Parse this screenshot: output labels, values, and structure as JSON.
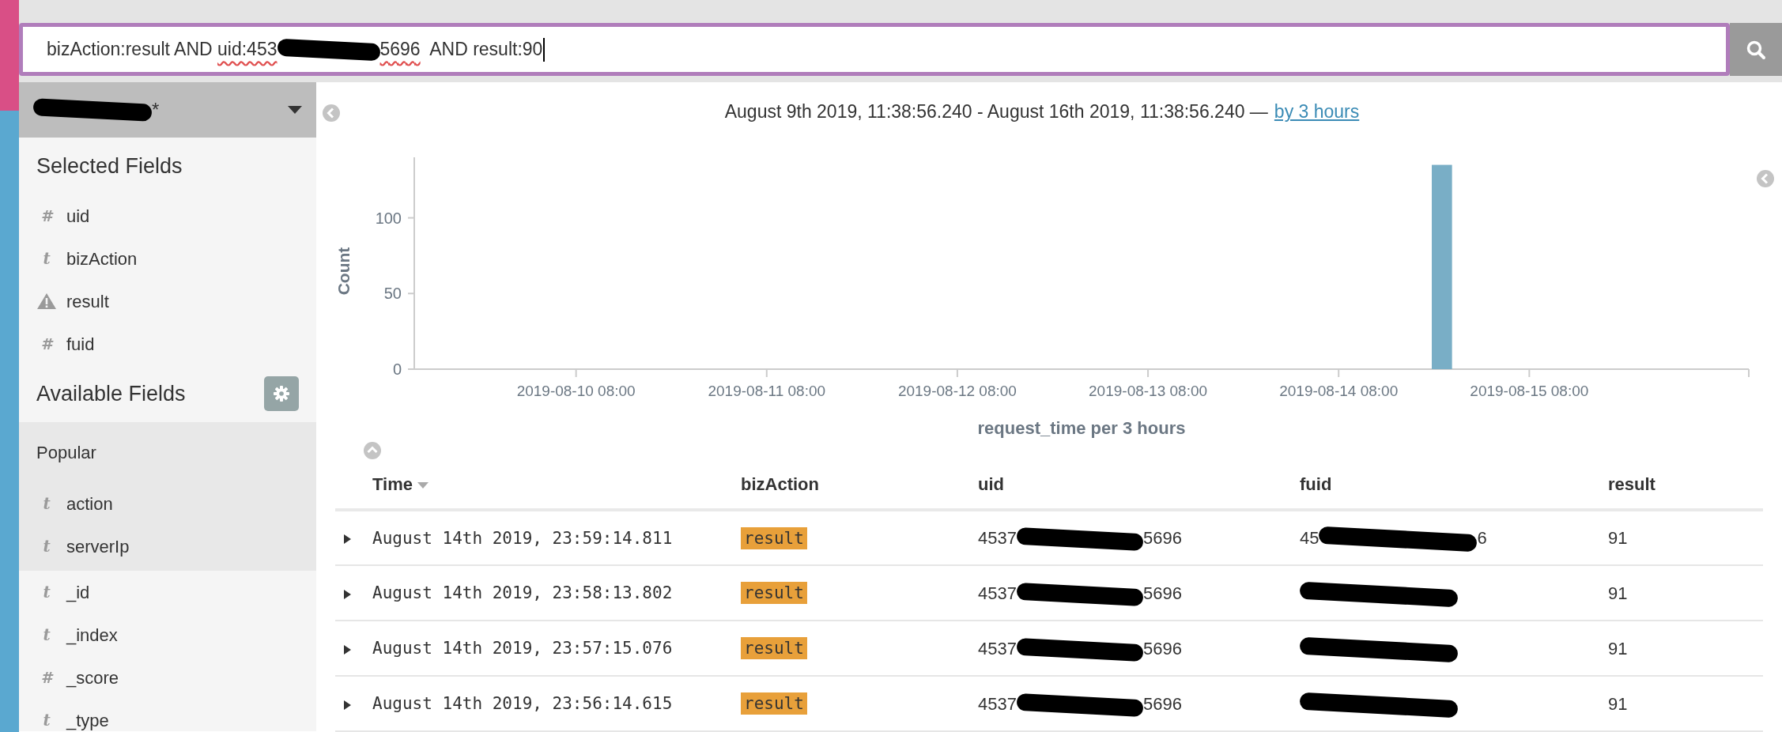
{
  "query": {
    "parts": [
      {
        "kind": "text",
        "text": "bizAction:result AND ",
        "misspelled": false
      },
      {
        "kind": "text",
        "text": "uid:453",
        "misspelled": true
      },
      {
        "kind": "redacted"
      },
      {
        "kind": "text",
        "text": "5696",
        "misspelled": true
      },
      {
        "kind": "text",
        "text": "  AND result:90",
        "misspelled": false
      }
    ]
  },
  "index_pattern": {
    "parts": [
      {
        "kind": "redacted"
      },
      {
        "kind": "text",
        "text": "*"
      }
    ]
  },
  "time_range": {
    "text": "August 9th 2019, 11:38:56.240 - August 16th 2019, 11:38:56.240 —",
    "interval_link": "by 3 hours"
  },
  "sidebar": {
    "selected_title": "Selected Fields",
    "selected_fields": [
      {
        "kind": "number",
        "icon": "#",
        "name": "uid"
      },
      {
        "kind": "string",
        "icon": "t",
        "name": "bizAction"
      },
      {
        "kind": "warning",
        "name": "result"
      },
      {
        "kind": "number",
        "icon": "#",
        "name": "fuid"
      }
    ],
    "available_title": "Available Fields",
    "popular_title": "Popular",
    "popular_fields": [
      {
        "kind": "string",
        "icon": "t",
        "name": "action"
      },
      {
        "kind": "string",
        "icon": "t",
        "name": "serverIp"
      }
    ],
    "other_fields": [
      {
        "kind": "string",
        "icon": "t",
        "name": "_id"
      },
      {
        "kind": "string",
        "icon": "t",
        "name": "_index"
      },
      {
        "kind": "number",
        "icon": "#",
        "name": "_score"
      },
      {
        "kind": "string",
        "icon": "t",
        "name": "_type"
      }
    ]
  },
  "chart_data": {
    "type": "bar",
    "xlabel": "request_time per 3 hours",
    "ylabel": "Count",
    "x": [
      "2019-08-14 21:00"
    ],
    "values": [
      135
    ],
    "xlim": [
      "2019-08-09 11:38",
      "2019-08-16 11:38"
    ],
    "ylim": [
      0,
      140
    ],
    "xticks": [
      "2019-08-10 08:00",
      "2019-08-11 08:00",
      "2019-08-12 08:00",
      "2019-08-13 08:00",
      "2019-08-14 08:00",
      "2019-08-15 08:00"
    ],
    "yticks": [
      0,
      50,
      100
    ]
  },
  "table": {
    "columns": [
      {
        "label": "Time",
        "sorted": true
      },
      {
        "label": "bizAction",
        "sorted": false
      },
      {
        "label": "uid",
        "sorted": false
      },
      {
        "label": "fuid",
        "sorted": false
      },
      {
        "label": "result",
        "sorted": false
      }
    ],
    "rows": [
      {
        "time": "August 14th 2019, 23:59:14.811",
        "bizAction": "result",
        "uid": [
          {
            "kind": "text",
            "text": "4537"
          },
          {
            "kind": "redacted"
          },
          {
            "kind": "text",
            "text": "5696"
          }
        ],
        "fuid": [
          {
            "kind": "text",
            "text": "45"
          },
          {
            "kind": "redacted"
          },
          {
            "kind": "text",
            "text": "6"
          }
        ],
        "result": "91"
      },
      {
        "time": "August 14th 2019, 23:58:13.802",
        "bizAction": "result",
        "uid": [
          {
            "kind": "text",
            "text": "4537"
          },
          {
            "kind": "redacted"
          },
          {
            "kind": "text",
            "text": "5696"
          }
        ],
        "fuid": [
          {
            "kind": "redacted"
          }
        ],
        "result": "91"
      },
      {
        "time": "August 14th 2019, 23:57:15.076",
        "bizAction": "result",
        "uid": [
          {
            "kind": "text",
            "text": "4537"
          },
          {
            "kind": "redacted"
          },
          {
            "kind": "text",
            "text": "5696"
          }
        ],
        "fuid": [
          {
            "kind": "redacted"
          }
        ],
        "result": "91"
      },
      {
        "time": "August 14th 2019, 23:56:14.615",
        "bizAction": "result",
        "uid": [
          {
            "kind": "text",
            "text": "4537"
          },
          {
            "kind": "redacted"
          },
          {
            "kind": "text",
            "text": "5696"
          }
        ],
        "fuid": [
          {
            "kind": "redacted"
          }
        ],
        "result": "91"
      }
    ]
  }
}
